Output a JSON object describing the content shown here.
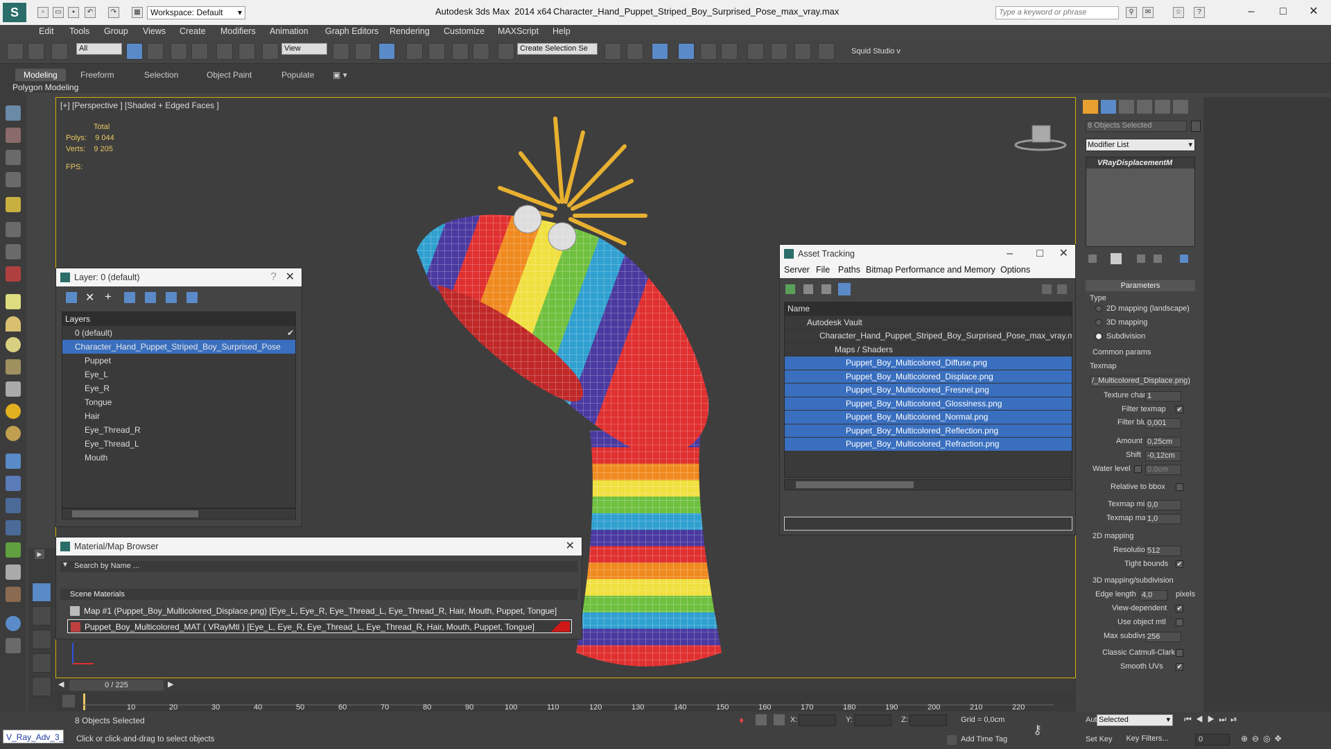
{
  "titlebar": {
    "workspace": "Workspace: Default",
    "app": "Autodesk 3ds Max  2014 x64",
    "file": "Character_Hand_Puppet_Striped_Boy_Surprised_Pose_max_vray.max",
    "search_placeholder": "Type a keyword or phrase"
  },
  "menu": [
    "Edit",
    "Tools",
    "Group",
    "Views",
    "Create",
    "Modifiers",
    "Animation",
    "Graph Editors",
    "Rendering",
    "Customize",
    "MAXScript",
    "Help"
  ],
  "toolbar": {
    "filter": "All",
    "coord_system": "View",
    "selection_set": "Create Selection Se",
    "studio": "Squid Studio v"
  },
  "ribbon": {
    "tabs": [
      "Modeling",
      "Freeform",
      "Selection",
      "Object Paint",
      "Populate"
    ],
    "sub": "Polygon Modeling"
  },
  "viewport": {
    "label": "[+] [Perspective ] [Shaded + Edged Faces ]",
    "stats_total": "Total",
    "polys_label": "Polys:",
    "polys": "9 044",
    "verts_label": "Verts:",
    "verts": "9 205",
    "fps": "FPS:"
  },
  "layer_dialog": {
    "title": "Layer: 0 (default)",
    "header": "Layers",
    "rows": [
      "0 (default)",
      "Character_Hand_Puppet_Striped_Boy_Surprised_Pose",
      "Puppet",
      "Eye_L",
      "Eye_R",
      "Tongue",
      "Hair",
      "Eye_Thread_R",
      "Eye_Thread_L",
      "Mouth"
    ]
  },
  "asset_dialog": {
    "title": "Asset Tracking",
    "menu": [
      "Server",
      "File",
      "Paths",
      "Bitmap Performance and Memory",
      "Options"
    ],
    "column": "Name",
    "rows": [
      "Autodesk Vault",
      "Character_Hand_Puppet_Striped_Boy_Surprised_Pose_max_vray.max",
      "Maps / Shaders",
      "Puppet_Boy_Multicolored_Diffuse.png",
      "Puppet_Boy_Multicolored_Displace.png",
      "Puppet_Boy_Multicolored_Fresnel.png",
      "Puppet_Boy_Multicolored_Glossiness.png",
      "Puppet_Boy_Multicolored_Normal.png",
      "Puppet_Boy_Multicolored_Reflection.png",
      "Puppet_Boy_Multicolored_Refraction.png"
    ]
  },
  "mat_browser": {
    "title": "Material/Map Browser",
    "search": "Search by Name ...",
    "section": "Scene Materials",
    "row1": "Map #1 (Puppet_Boy_Multicolored_Displace.png) [Eye_L, Eye_R, Eye_Thread_L, Eye_Thread_R, Hair, Mouth, Puppet, Tongue]",
    "row2": "Puppet_Boy_Multicolored_MAT ( VRayMtl ) [Eye_L, Eye_R, Eye_Thread_L, Eye_Thread_R, Hair, Mouth, Puppet, Tongue]"
  },
  "rightpanel": {
    "selected": "8 Objects Selected",
    "modifier_list": "Modifier List",
    "modifier": "VRayDisplacementM",
    "parameters": "Parameters",
    "type": "Type",
    "opt_2d": "2D mapping (landscape)",
    "opt_3d": "3D mapping",
    "opt_sub": "Subdivision",
    "common": "Common params",
    "texmap": "Texmap",
    "texmap_value": "/_Multicolored_Displace.png)",
    "texture_chan": "Texture chan",
    "texture_chan_v": "1",
    "filter_texmap": "Filter texmap",
    "filter_blur": "Filter blur",
    "filter_blur_v": "0,001",
    "amount": "Amount",
    "amount_v": "0,25cm",
    "shift": "Shift",
    "shift_v": "-0,12cm",
    "water": "Water level",
    "water_v": "0,0cm",
    "relative": "Relative to bbox",
    "tmin": "Texmap min",
    "tmin_v": "0,0",
    "tmax": "Texmap max",
    "tmax_v": "1,0",
    "map2d": "2D mapping",
    "resolution": "Resolution",
    "resolution_v": "512",
    "tight": "Tight bounds",
    "map3d": "3D mapping/subdivision",
    "edge": "Edge length",
    "edge_v": "4,0",
    "pixels": "pixels",
    "viewdep": "View-dependent",
    "useobj": "Use object mtl",
    "maxsub": "Max subdivs",
    "maxsub_v": "256",
    "catmull": "Classic Catmull-Clark",
    "smooth": "Smooth UVs"
  },
  "timeline": {
    "frame": "0 / 225",
    "ticks": [
      "10",
      "20",
      "30",
      "40",
      "50",
      "60",
      "70",
      "80",
      "90",
      "100",
      "110",
      "120",
      "130",
      "140",
      "150",
      "160",
      "170",
      "180",
      "190",
      "200",
      "210",
      "220"
    ]
  },
  "status": {
    "script": "V_Ray_Adv_3_",
    "selected": "8 Objects Selected",
    "prompt": "Click or click-and-drag to select objects",
    "x": "X:",
    "y": "Y:",
    "z": "Z:",
    "grid": "Grid = 0,0cm",
    "add_time_tag": "Add Time Tag",
    "auto_key": "Auto Key",
    "set_key": "Set Key",
    "key_mode": "Selected",
    "key_filters": "Key Filters...",
    "frame_field": "0"
  }
}
